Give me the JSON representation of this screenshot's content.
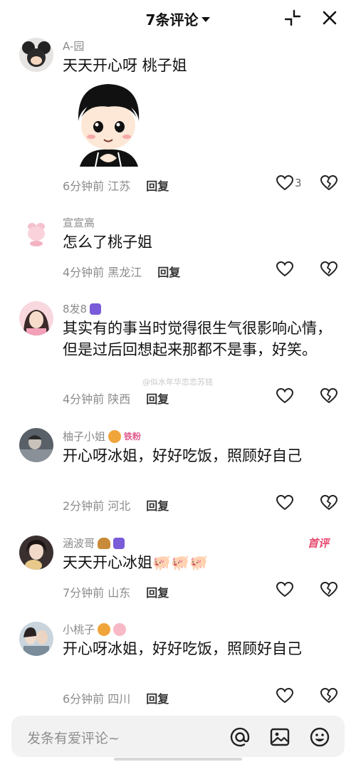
{
  "header": {
    "title": "7条评论",
    "icons": [
      "collapse-icon",
      "close-icon"
    ]
  },
  "comments": [
    {
      "username": "A-园",
      "text": "天天开心呀 桃子姐",
      "has_sticker": true,
      "time_location": "6分钟前 江苏",
      "reply": "回复",
      "likes": "3"
    },
    {
      "username": "宣宣高",
      "text": "怎么了桃子姐",
      "time_location": "4分钟前 黑龙江",
      "reply": "回复"
    },
    {
      "username": "8发8",
      "text": "其实有的事当时觉得很生气很影响心情，但是过后回想起来那都不是事，好笑。",
      "time_location": "4分钟前 陕西",
      "reply": "回复"
    },
    {
      "username": "柚子小姐",
      "fan_badge": "铁粉",
      "text": "开心呀冰姐，好好吃饭，照顾好自己",
      "time_location": "2分钟前 河北",
      "reply": "回复"
    },
    {
      "username": "涵波哥",
      "first_tag": "首评",
      "text": "天天开心冰姐🐖🐖🐖",
      "time_location": "7分钟前 山东",
      "reply": "回复"
    },
    {
      "username": "小桃子",
      "text": "开心呀冰姐，好好吃饭，照顾好自己",
      "time_location": "6分钟前 四川",
      "reply": "回复"
    }
  ],
  "watermark": "@似水年华恋恋苏铭",
  "input": {
    "placeholder": "发条有爱评论~",
    "icons": [
      "at-icon",
      "image-icon",
      "emoji-icon"
    ]
  },
  "colors": {
    "badge_purple": "#7a5cd8",
    "first_tag": "#e84a6f"
  }
}
